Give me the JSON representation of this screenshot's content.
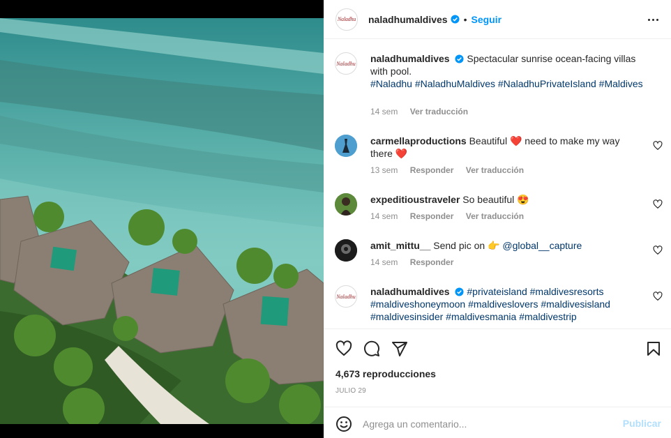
{
  "media": {
    "kind": "aerial-photo-villas"
  },
  "header": {
    "username": "naladhumaldives",
    "logo_text": "Naladhu",
    "follow_label": "Seguir",
    "separator": "•"
  },
  "caption": {
    "username": "naladhumaldives",
    "text": "Spectacular sunrise ocean-facing villas with pool.",
    "hashtags": "#Naladhu #NaladhuMaldives #NaladhuPrivateIsland #Maldives",
    "time": "14 sem",
    "translate": "Ver traducción"
  },
  "comments": [
    {
      "username": "carmellaproductions",
      "text_a": "Beautiful",
      "emoji_a": "❤️",
      "text_b": "need to make my way there",
      "emoji_b": "❤️",
      "time": "13 sem",
      "reply": "Responder",
      "translate": "Ver traducción"
    },
    {
      "username": "expeditioustraveler",
      "text": "So beautiful",
      "emoji": "😍",
      "time": "14 sem",
      "reply": "Responder",
      "translate": "Ver traducción"
    },
    {
      "username": "amit_mittu__",
      "text": "Send pic on",
      "emoji": "👉",
      "mention": "@global__capture",
      "time": "14 sem",
      "reply": "Responder"
    },
    {
      "username": "naladhumaldives",
      "hashtags_1": "#privateisland #maldivesresorts",
      "hashtags_2": "#maldiveshoneymoon #maldiveslovers #maldivesisland",
      "hashtags_3": "#maldivesinsider #maldivesmania #maldivestrip"
    }
  ],
  "stats": {
    "views": "4,673 reproducciones",
    "date": "JULIO 29"
  },
  "add_comment": {
    "placeholder": "Agrega un comentario...",
    "publish_label": "Publicar"
  },
  "colors": {
    "link_blue": "#0095f6",
    "hashtag": "#00376b",
    "muted": "#8e8e8e",
    "publish_disabled": "#b2dffc"
  },
  "icons": [
    "verified-badge-icon",
    "more-options-icon",
    "heart-icon",
    "comment-icon",
    "share-icon",
    "save-icon",
    "emoji-icon",
    "like-comment-icon"
  ]
}
